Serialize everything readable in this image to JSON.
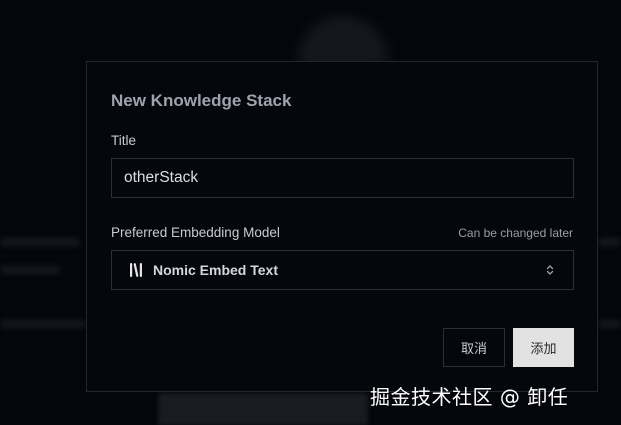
{
  "dialog": {
    "title": "New Knowledge Stack",
    "title_label": "Title",
    "title_value": "otherStack",
    "model_label": "Preferred Embedding Model",
    "model_hint": "Can be changed later",
    "model_value": "Nomic Embed Text",
    "model_icon": "nomic-logo-icon",
    "cancel_label": "取消",
    "add_label": "添加"
  },
  "watermark": "掘金技术社区 @ 卸任"
}
